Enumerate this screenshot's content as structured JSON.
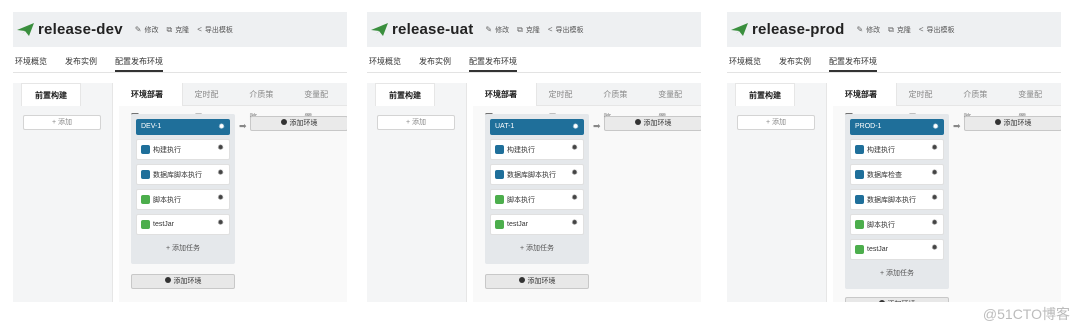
{
  "header_actions": {
    "edit_label": "修改",
    "clone_label": "克隆",
    "export_label": "导出模板"
  },
  "main_tabs": [
    "环境概览",
    "发布实例",
    "配置发布环境"
  ],
  "left_tab_label": "前置构建",
  "left_add_label": "+ 添加",
  "right_tabs": [
    "环境部署图",
    "定时配置",
    "介质策略",
    "变量配置"
  ],
  "add_task_label": "+ 添加任务",
  "add_env_label": "添加环境",
  "panels": [
    {
      "title": "release-dev",
      "env_name": "DEV-1",
      "tasks": [
        {
          "label": "构建执行",
          "icon": "blue"
        },
        {
          "label": "数据库脚本执行",
          "icon": "blue"
        },
        {
          "label": "脚本执行",
          "icon": "green"
        },
        {
          "label": "testJar",
          "icon": "green"
        }
      ]
    },
    {
      "title": "release-uat",
      "env_name": "UAT-1",
      "tasks": [
        {
          "label": "构建执行",
          "icon": "blue"
        },
        {
          "label": "数据库脚本执行",
          "icon": "blue"
        },
        {
          "label": "脚本执行",
          "icon": "green"
        },
        {
          "label": "testJar",
          "icon": "green"
        }
      ]
    },
    {
      "title": "release-prod",
      "env_name": "PROD-1",
      "tasks": [
        {
          "label": "构建执行",
          "icon": "blue"
        },
        {
          "label": "数据库检查",
          "icon": "blue"
        },
        {
          "label": "数据库脚本执行",
          "icon": "blue"
        },
        {
          "label": "脚本执行",
          "icon": "green"
        },
        {
          "label": "testJar",
          "icon": "green"
        }
      ]
    }
  ],
  "watermark": "@51CTO博客",
  "colors": {
    "logo_green": "#3a8f3e",
    "env_header_blue": "#1f6f9a",
    "task_icon_green": "#4cae4c"
  }
}
